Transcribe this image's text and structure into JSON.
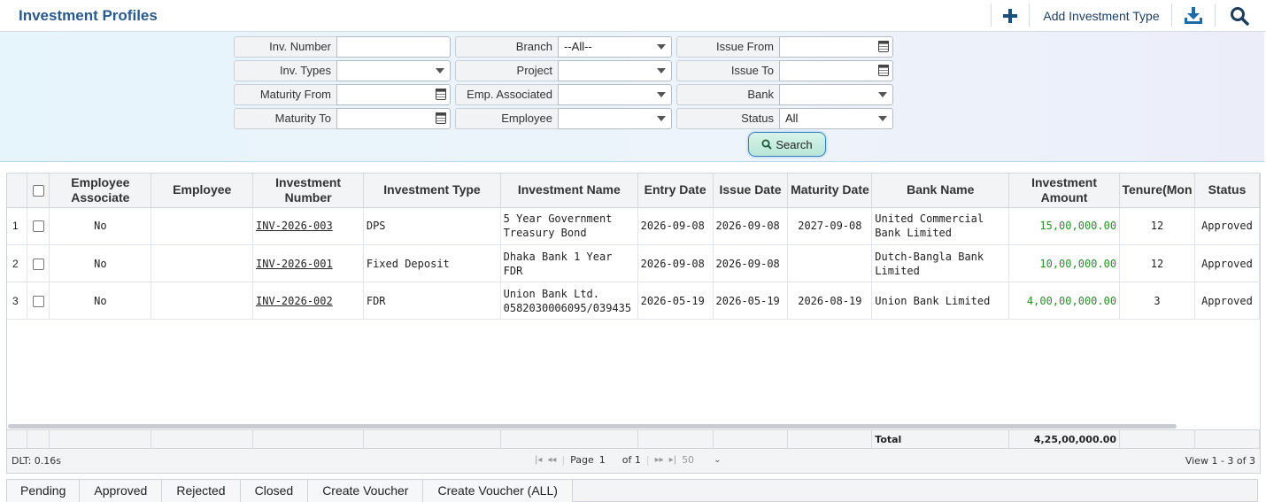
{
  "header": {
    "title": "Investment Profiles",
    "add_icon": "plus-icon",
    "add_type_label": "Add Investment Type",
    "download_icon": "download-icon",
    "search_icon": "search-icon"
  },
  "filters": {
    "inv_number": {
      "label": "Inv. Number",
      "value": ""
    },
    "branch": {
      "label": "Branch",
      "value": "--All--"
    },
    "issue_from": {
      "label": "Issue From",
      "value": ""
    },
    "inv_types": {
      "label": "Inv. Types",
      "value": ""
    },
    "project": {
      "label": "Project",
      "value": ""
    },
    "issue_to": {
      "label": "Issue To",
      "value": ""
    },
    "maturity_from": {
      "label": "Maturity From",
      "value": ""
    },
    "emp_associated": {
      "label": "Emp. Associated",
      "value": ""
    },
    "bank": {
      "label": "Bank",
      "value": ""
    },
    "maturity_to": {
      "label": "Maturity To",
      "value": ""
    },
    "employee": {
      "label": "Employee",
      "value": ""
    },
    "status": {
      "label": "Status",
      "value": "All"
    },
    "search_label": "Search"
  },
  "table": {
    "columns": [
      "Employee Associate",
      "Employee",
      "Investment Number",
      "Investment Type",
      "Investment Name",
      "Entry Date",
      "Issue Date",
      "Maturity Date",
      "Bank Name",
      "Investment Amount",
      "Tenure(Mon",
      "Status"
    ],
    "rows": [
      {
        "rn": "1",
        "emp_assoc": "No",
        "employee": "",
        "inv_number": "INV-2026-003",
        "inv_type": "DPS",
        "inv_name": "5 Year Government Treasury Bond",
        "entry_date": "2026-09-08",
        "issue_date": "2026-09-08",
        "maturity_date": "2027-09-08",
        "bank": "United Commercial Bank Limited",
        "amount": "15,00,000.00",
        "tenure": "12",
        "status": "Approved"
      },
      {
        "rn": "2",
        "emp_assoc": "No",
        "employee": "",
        "inv_number": "INV-2026-001",
        "inv_type": "Fixed Deposit",
        "inv_name": "Dhaka Bank 1 Year FDR",
        "entry_date": "2026-09-08",
        "issue_date": "2026-09-08",
        "maturity_date": "",
        "bank": "Dutch-Bangla Bank Limited",
        "amount": "10,00,000.00",
        "tenure": "12",
        "status": "Approved"
      },
      {
        "rn": "3",
        "emp_assoc": "No",
        "employee": "",
        "inv_number": "INV-2026-002",
        "inv_type": "FDR",
        "inv_name": "Union Bank Ltd. 0582030006095/039435",
        "entry_date": "2026-05-19",
        "issue_date": "2026-05-19",
        "maturity_date": "2026-08-19",
        "bank": "Union Bank Limited",
        "amount": "4,00,00,000.00",
        "tenure": "3",
        "status": "Approved"
      }
    ],
    "footer": {
      "total_label": "Total",
      "total_amount": "4,25,00,000.00"
    }
  },
  "pager": {
    "dlt": "DLT: 0.16s",
    "page_label": "Page",
    "page_value": "1",
    "of_label": "of 1",
    "page_size": "50",
    "view": "View 1 - 3 of 3"
  },
  "tabs": [
    "Pending",
    "Approved",
    "Rejected",
    "Closed",
    "Create Voucher",
    "Create Voucher (ALL)"
  ]
}
